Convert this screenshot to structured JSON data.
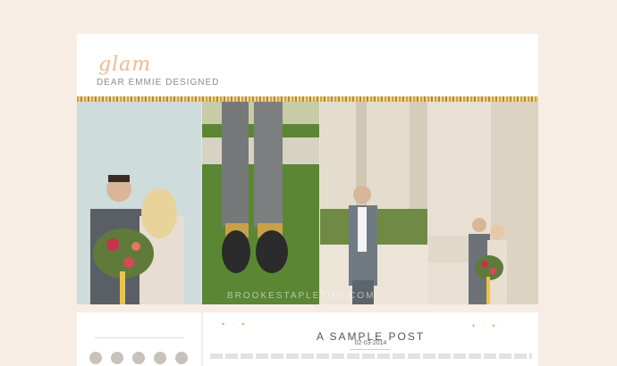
{
  "header": {
    "logo_script": "glam",
    "logo_sub": "DEAR EMMIE DESIGNED"
  },
  "collage": {
    "watermark": "BROOKESTAPLETON.COM"
  },
  "sidebar": {
    "social_icons": [
      "facebook-icon",
      "twitter-icon",
      "pinterest-icon",
      "instagram-icon",
      "email-icon"
    ]
  },
  "post": {
    "title": "A SAMPLE POST",
    "date": "02-03-2014"
  },
  "colors": {
    "background": "#f7ede4",
    "logo_accent": "#f0b98e",
    "glitter": "#c9a24a"
  }
}
